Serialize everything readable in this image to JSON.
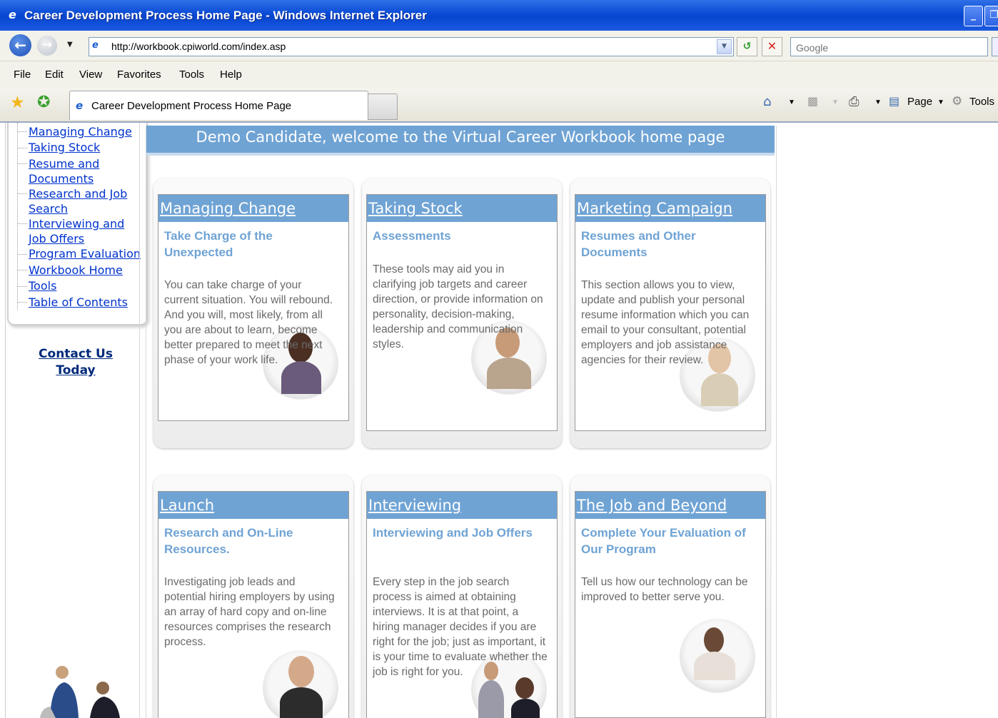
{
  "window": {
    "title": "Career Development Process Home Page - Windows Internet Explorer",
    "minimize": "_",
    "restore": "❐"
  },
  "addressbar": {
    "url": "http://workbook.cpiworld.com/index.asp",
    "search_placeholder": "Google"
  },
  "menu": [
    "File",
    "Edit",
    "View",
    "Favorites",
    "Tools",
    "Help"
  ],
  "tab": {
    "label": "Career Development Process Home Page"
  },
  "commandbar": {
    "page_label": "Page",
    "tools_label": "Tools"
  },
  "sidebar": {
    "items": [
      {
        "label": "Managing Change"
      },
      {
        "label": "Taking Stock"
      },
      {
        "label": "Resume and"
      },
      {
        "label": "Documents"
      },
      {
        "label": "Research and Job"
      },
      {
        "label": "Search"
      },
      {
        "label": "Interviewing and"
      },
      {
        "label": "Job Offers"
      },
      {
        "label": "Program Evaluation"
      },
      {
        "label": "Workbook Home"
      },
      {
        "label": "Tools"
      },
      {
        "label": "Table of Contents"
      }
    ],
    "contact_line1": "Contact Us",
    "contact_line2": "Today"
  },
  "main": {
    "welcome": "Demo Candidate, welcome to the Virtual Career Workbook home page",
    "cards": [
      {
        "title": "Managing Change",
        "subtitle": "Take Charge of the Unexpected",
        "body": "You can take charge of your current situation. You will rebound. And you will, most likely, from all you are about to learn, become better prepared to meet the next phase of your work life."
      },
      {
        "title": "Taking Stock",
        "subtitle": "Assessments",
        "body": "These tools may aid you in clarifying job targets and career direction, or provide information on personality, decision-making, leadership and communication styles."
      },
      {
        "title": "Marketing Campaign",
        "subtitle": "Resumes and Other Documents",
        "body": "This section allows you to view, update and publish your personal resume information which you can email to your consultant, potential employers and job assistance agencies for their review."
      },
      {
        "title": "Launch",
        "subtitle": "Research and On-Line Resources.",
        "body": "Investigating job leads and potential hiring employers by using an array of hard copy and on-line resources comprises the research process."
      },
      {
        "title": "Interviewing",
        "subtitle": "Interviewing and Job Offers",
        "body": "Every step in the job search process is aimed at obtaining interviews.  It is at that point, a hiring manager decides if you are right for the job; just as important, it is your time to evaluate whether the job is right for you."
      },
      {
        "title": "The Job and Beyond",
        "subtitle": "Complete Your Evaluation of Our Program",
        "body": "Tell us how our technology can be improved to better serve you."
      }
    ]
  },
  "colors": {
    "accent": "#6fa3d4",
    "link": "#0033cc",
    "titlebar": "#0a4bd6"
  }
}
